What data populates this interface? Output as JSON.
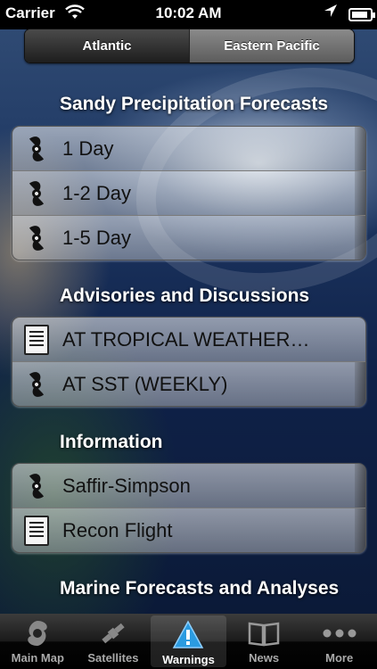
{
  "status_bar": {
    "carrier": "Carrier",
    "time": "10:02 AM"
  },
  "segmented": {
    "options": [
      "Atlantic",
      "Eastern Pacific"
    ],
    "selected": "Atlantic"
  },
  "sections": [
    {
      "title": "Sandy Precipitation Forecasts",
      "items": [
        {
          "label": "1 Day",
          "icon": "storm-symbol-icon"
        },
        {
          "label": "1-2 Day",
          "icon": "storm-symbol-icon"
        },
        {
          "label": "1-5 Day",
          "icon": "storm-symbol-icon"
        }
      ]
    },
    {
      "title": "Advisories and Discussions",
      "items": [
        {
          "label": "AT TROPICAL WEATHER…",
          "icon": "document-icon"
        },
        {
          "label": "AT SST (WEEKLY)",
          "icon": "storm-symbol-icon"
        }
      ]
    },
    {
      "title": "Information",
      "items": [
        {
          "label": "Saffir-Simpson",
          "icon": "storm-symbol-icon"
        },
        {
          "label": "Recon Flight",
          "icon": "document-icon"
        }
      ]
    },
    {
      "title": "Marine Forecasts and Analyses",
      "items": []
    }
  ],
  "tab_bar": {
    "tabs": [
      {
        "label": "Main Map",
        "icon": "hurricane-icon"
      },
      {
        "label": "Satellites",
        "icon": "satellite-icon"
      },
      {
        "label": "Warnings",
        "icon": "warning-icon"
      },
      {
        "label": "News",
        "icon": "book-icon"
      },
      {
        "label": "More",
        "icon": "more-dots-icon"
      }
    ],
    "selected": "Warnings"
  }
}
